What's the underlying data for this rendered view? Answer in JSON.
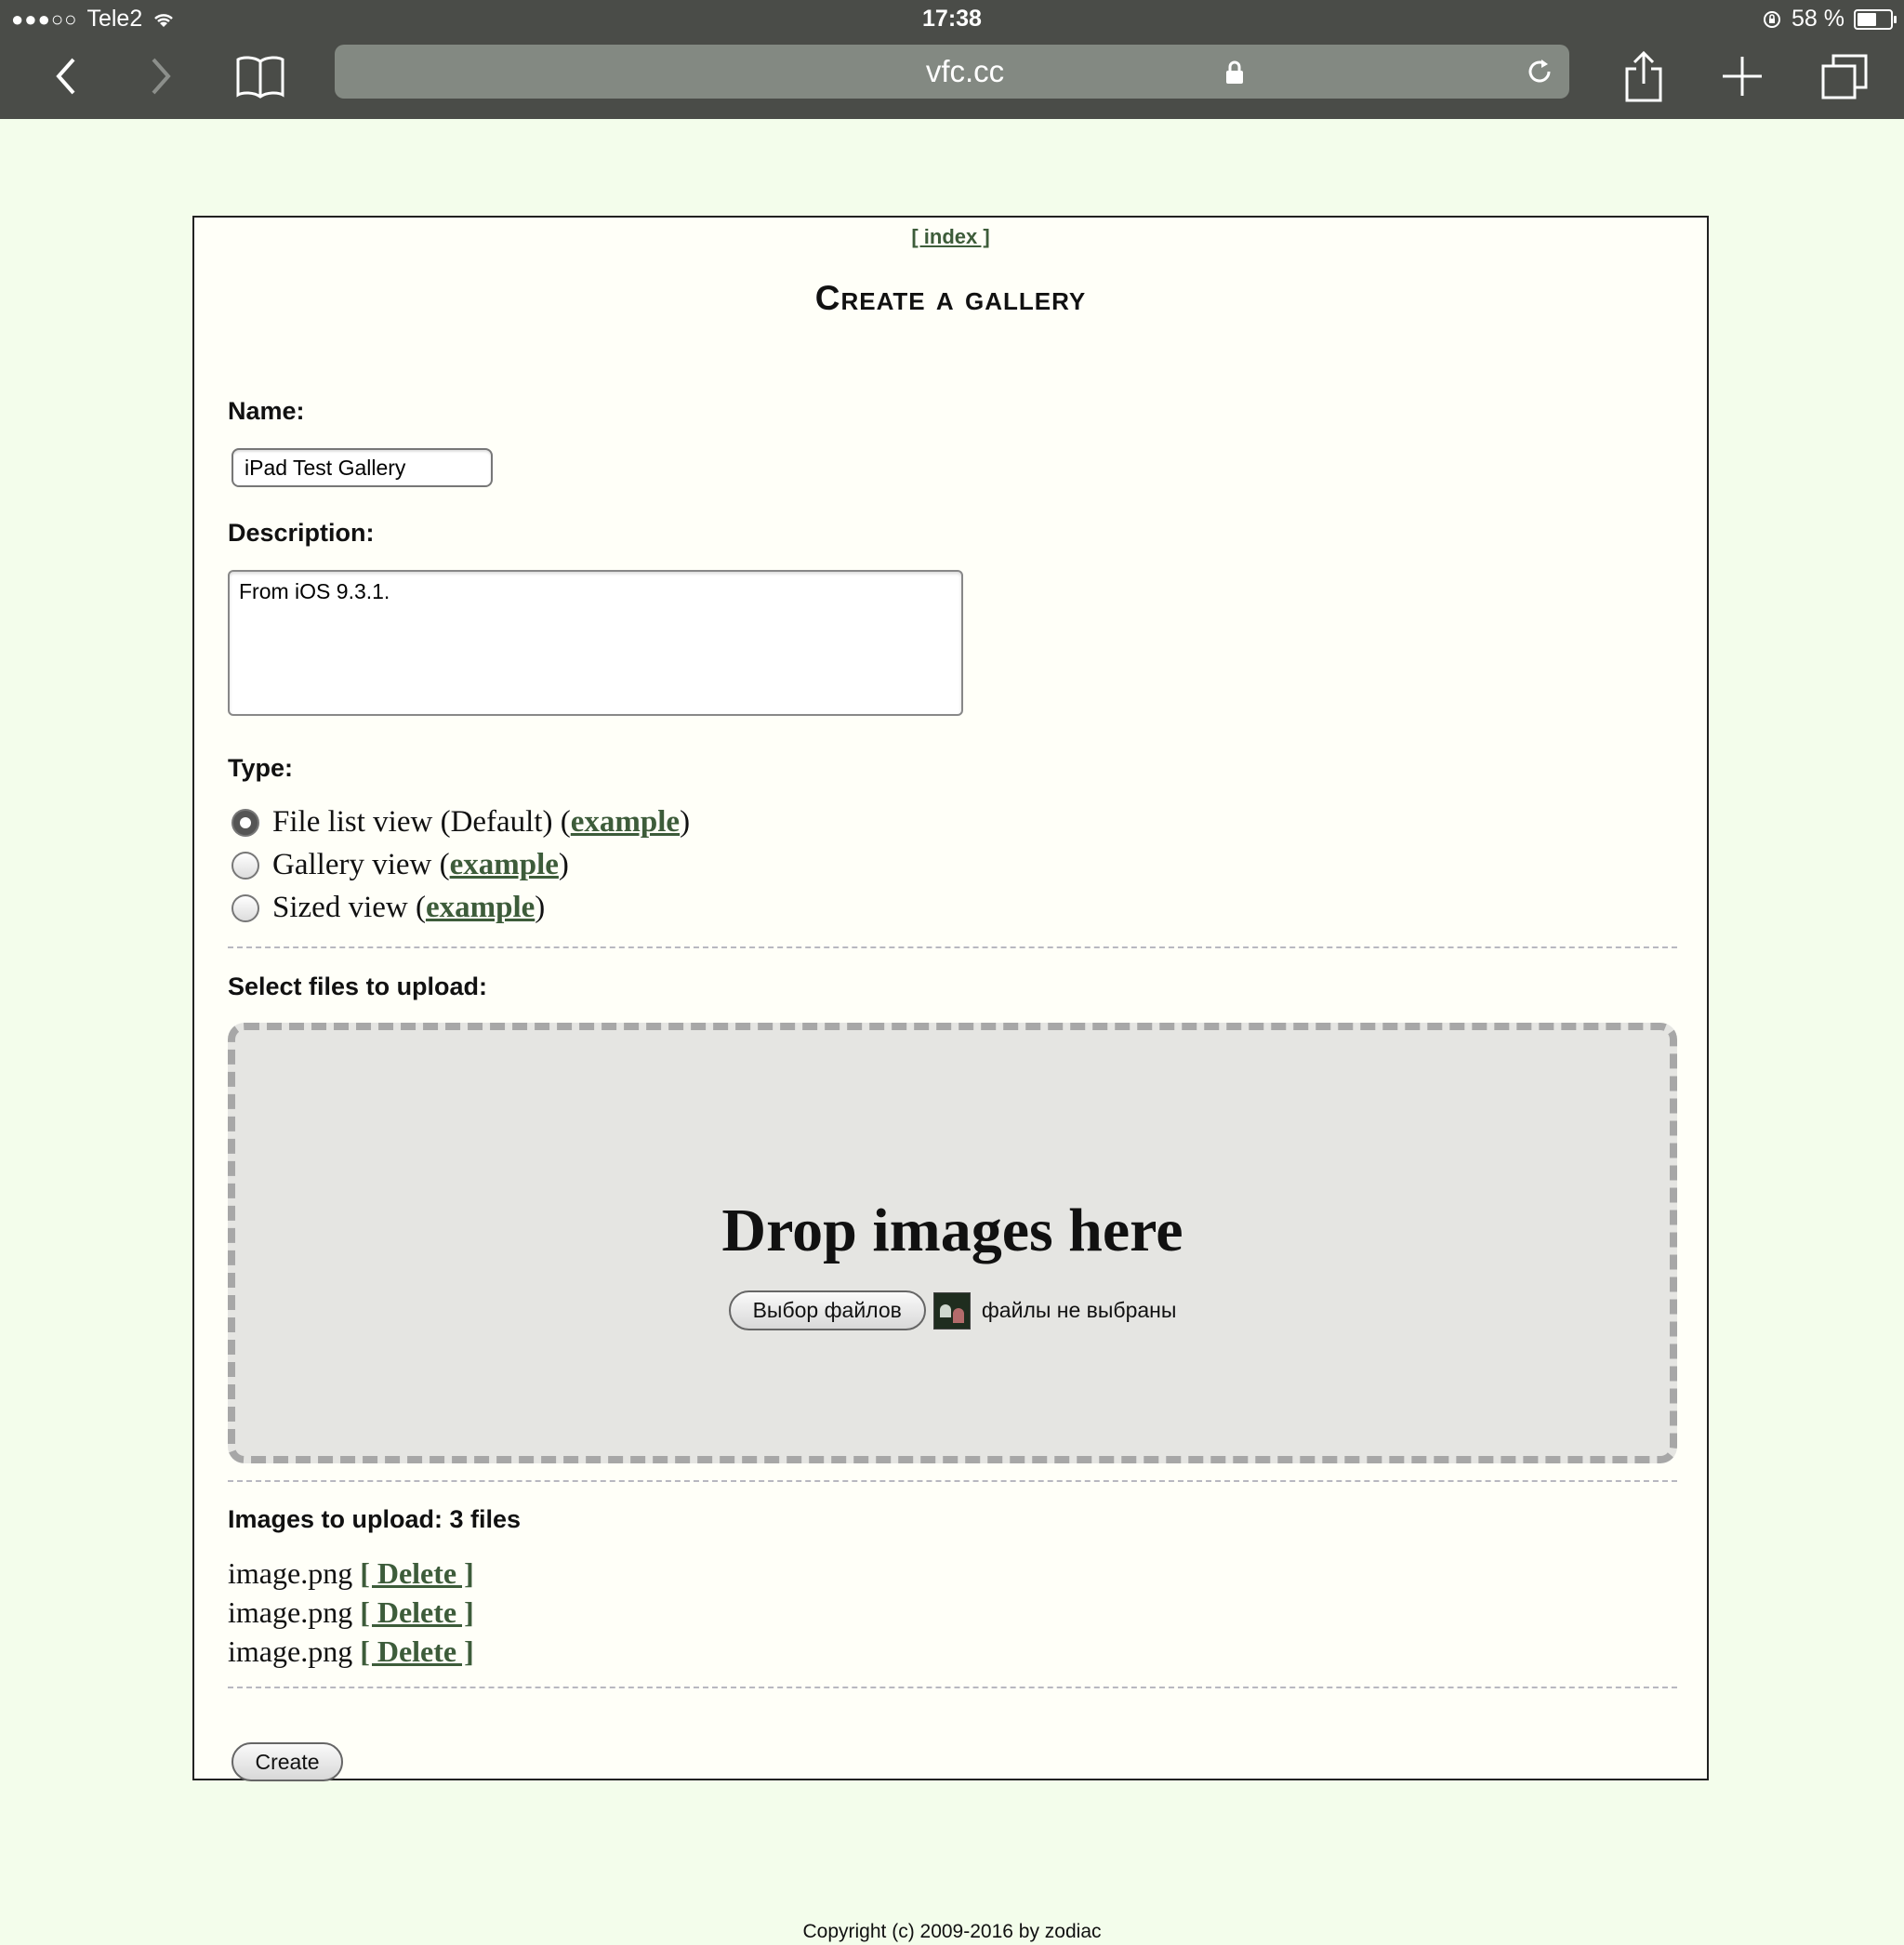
{
  "status_bar": {
    "signal": "●●●○○",
    "carrier": "Tele2",
    "time": "17:38",
    "battery_pct": "58 %"
  },
  "browser": {
    "url": "vfc.cc",
    "icons": [
      "back-icon",
      "forward-icon",
      "bookmarks-icon",
      "lock-icon",
      "reload-icon",
      "share-icon",
      "new-tab-icon",
      "tabs-icon"
    ]
  },
  "page": {
    "index_link": "[ index ]",
    "title": "Create a gallery",
    "name_label": "Name:",
    "name_value": "iPad Test Gallery",
    "description_label": "Description:",
    "description_value": "From iOS 9.3.1.",
    "type_label": "Type:",
    "types": [
      {
        "text": "File list view (Default) (",
        "link": "example",
        "close": ")",
        "checked": true
      },
      {
        "text": "Gallery view (",
        "link": "example",
        "close": ")",
        "checked": false
      },
      {
        "text": "Sized view (",
        "link": "example",
        "close": ")",
        "checked": false
      }
    ],
    "select_label": "Select files to upload:",
    "drop_title": "Drop images here",
    "choose_files_button": "Выбор файлов",
    "file_status": "файлы не выбраны",
    "images_label": "Images to upload: 3 files",
    "uploads": [
      {
        "name": "image.png",
        "delete": "[ Delete ]"
      },
      {
        "name": "image.png",
        "delete": "[ Delete ]"
      },
      {
        "name": "image.png",
        "delete": "[ Delete ]"
      }
    ],
    "create_button": "Create",
    "copyright": "Copyright (c) 2009-2016 by zodiac"
  },
  "colors": {
    "page_bg": "#f3fdeb",
    "link": "#3d5c3a",
    "chrome": "#4a4c48"
  }
}
